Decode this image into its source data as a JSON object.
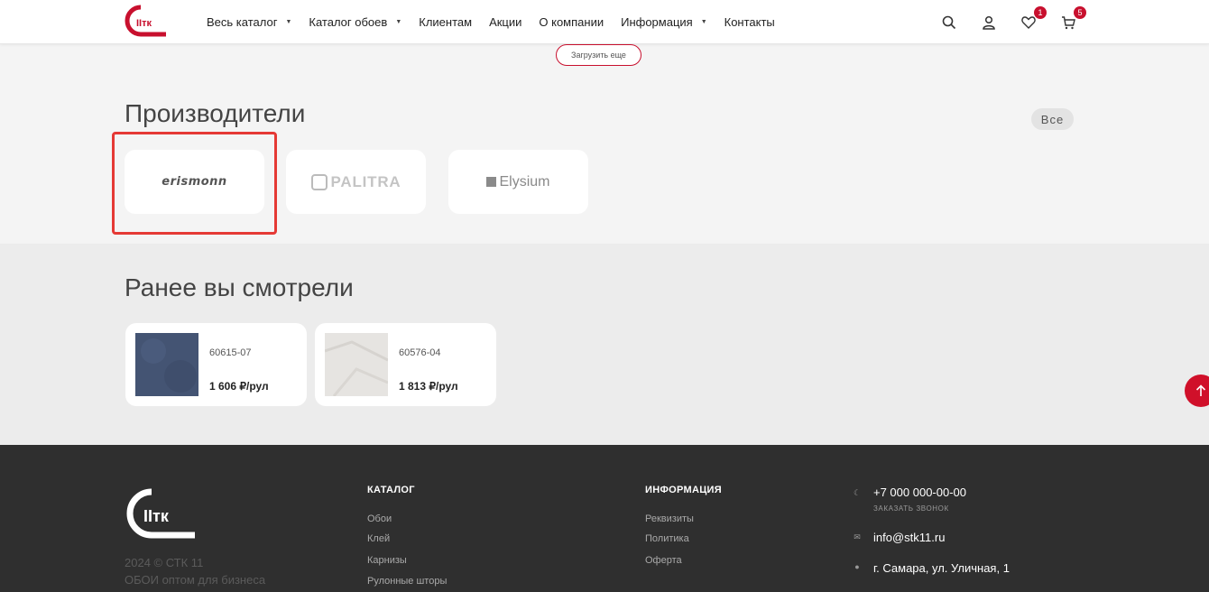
{
  "header": {
    "nav": [
      {
        "label": "Весь каталог",
        "caret": true
      },
      {
        "label": "Каталог обоев",
        "caret": true
      },
      {
        "label": "Клиентам",
        "caret": false
      },
      {
        "label": "Акции",
        "caret": false
      },
      {
        "label": "О компании",
        "caret": false
      },
      {
        "label": "Информация",
        "caret": true
      },
      {
        "label": "Контакты",
        "caret": false
      }
    ],
    "favorites_count": "1",
    "cart_count": "5"
  },
  "load_more_label": "Загрузить еще",
  "manufacturers": {
    "title": "Производители",
    "all_label": "Все",
    "brands": [
      "erismonn",
      "PALITRA",
      "Elysium"
    ]
  },
  "viewed": {
    "title": "Ранее вы смотрели",
    "products": [
      {
        "sku": "60615-07",
        "price": "1 606 ₽/рул",
        "swatch": "#4a5a7a"
      },
      {
        "sku": "60576-04",
        "price": "1 813 ₽/рул",
        "swatch": "#e4e2df"
      }
    ]
  },
  "footer": {
    "copyright": "2024 © СТК 11",
    "tagline": "ОБОИ оптом для бизнеса",
    "catalog": {
      "title": "КАТАЛОГ",
      "links": [
        "Обои",
        "Клей",
        "Карнизы",
        "Рулонные шторы"
      ]
    },
    "info": {
      "title": "ИНФОРМАЦИЯ",
      "links": [
        "Реквизиты",
        "Политика",
        "Оферта"
      ]
    },
    "phone": "+7 000 000-00-00",
    "callback": "ЗАКАЗАТЬ ЗВОНОК",
    "email": "info@stk11.ru",
    "address": "г. Самара, ул. Уличная, 1"
  },
  "colors": {
    "accent": "#c8102e",
    "footer_bg": "#2f2f2f"
  }
}
